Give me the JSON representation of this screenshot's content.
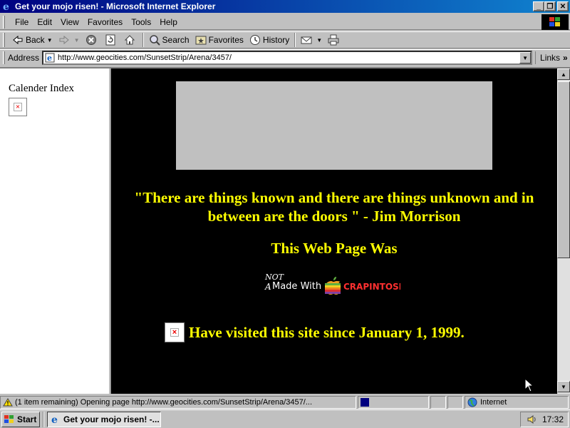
{
  "window": {
    "title": "Get your mojo risen! - Microsoft Internet Explorer",
    "minimize_glyph": "_",
    "maximize_glyph": "❐",
    "close_glyph": "✕"
  },
  "menu": {
    "items": [
      "File",
      "Edit",
      "View",
      "Favorites",
      "Tools",
      "Help"
    ]
  },
  "toolbar": {
    "back_label": "Back",
    "stop_icon": "stop-icon",
    "search_label": "Search",
    "favorites_label": "Favorites",
    "history_label": "History"
  },
  "address": {
    "label": "Address",
    "url": "http://www.geocities.com/SunsetStrip/Arena/3457/",
    "links_label": "Links",
    "links_chevron": "»"
  },
  "left_frame": {
    "title": "Calender Index"
  },
  "main_frame": {
    "quote": "\"There are things known and there are things unknown and in between are the doors \" - Jim Morrison",
    "made_with": "This Web Page Was",
    "logo_not": "NOT",
    "logo_a": "A",
    "logo_made": "Made With",
    "logo_brand": "CRAPINTOSH",
    "counter_text": "Have visited this site since January 1, 1999.",
    "text_color": "#ffff00",
    "background_color": "#000000"
  },
  "statusbar": {
    "message": "(1 item remaining) Opening page http://www.geocities.com/SunsetStrip/Arena/3457/...",
    "zone": "Internet"
  },
  "taskbar": {
    "start_label": "Start",
    "task_label": "Get your mojo risen! -...",
    "clock": "17:32"
  }
}
